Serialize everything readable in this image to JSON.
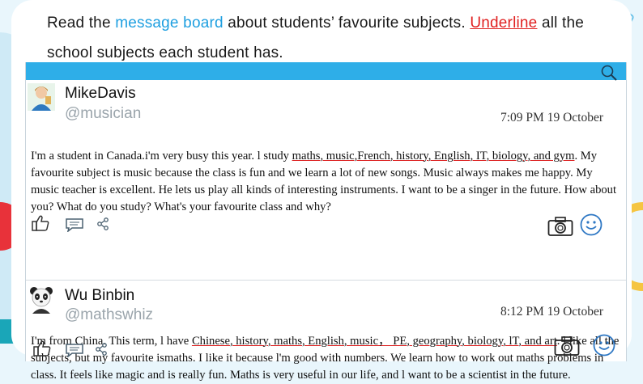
{
  "instruction": {
    "part1": "Read the ",
    "highlight": "message board",
    "part2": " about students’ favourite subjects. ",
    "underline_word": "Underline",
    "part3": " all the school subjects each student has."
  },
  "board": {
    "search_icon": "search-icon",
    "posts": [
      {
        "name": "MikeDavis",
        "handle": "@musician",
        "time": "7:09 PM 19 October",
        "text_before": "I'm a student in Canada.i'm very busy this year. l study ",
        "text_subjects": "maths, music,French, history, English, IT, biology, and gym",
        "text_after": ". My favourite subject is music because the class is fun and we learn a lot of new songs. Music always makes me happy. My music teacher is excellent. He lets us play all kinds of interesting instruments. I want to be a singer in the future. How about you? What do you study? What's your favourite class and why?"
      },
      {
        "name": "Wu Binbin",
        "handle": "@mathswhiz",
        "time": "8:12 PM 19 October",
        "text_before": "I'm from China. This term, l have ",
        "text_subjects": "Chinese, history, maths, English, music， PE, geography, biology, lT, and art",
        "text_after": ". l like all the subjects, but my favourite ismaths. I like it because l'm good with numbers. We learn how to work out maths problems in class. It feels like magic and is really fun. Maths is very useful in our life, and l want to be a scientist in the future."
      }
    ]
  },
  "colors": {
    "accent_blue": "#1e9fe0",
    "underline_red": "#e02020",
    "bar_blue": "#2eaee8"
  },
  "icons": [
    "thumbs-up-icon",
    "comment-icon",
    "share-icon",
    "camera-icon",
    "smile-icon"
  ]
}
